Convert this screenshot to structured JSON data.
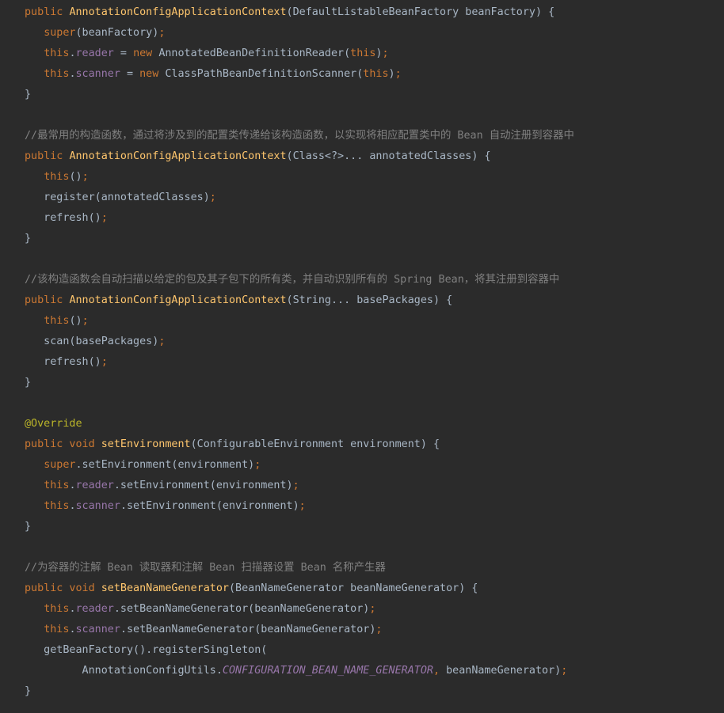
{
  "code_lines": [
    [
      {
        "t": "public ",
        "c": "kw"
      },
      {
        "t": "AnnotationConfigApplicationContext",
        "c": "fn"
      },
      {
        "t": "(DefaultListableBeanFactory beanFactory) {",
        "c": "txt"
      }
    ],
    [
      {
        "t": "   ",
        "c": "txt"
      },
      {
        "t": "super",
        "c": "kw"
      },
      {
        "t": "(beanFactory)",
        "c": "txt"
      },
      {
        "t": ";",
        "c": "kw"
      }
    ],
    [
      {
        "t": "   ",
        "c": "txt"
      },
      {
        "t": "this",
        "c": "kw"
      },
      {
        "t": ".",
        "c": "txt"
      },
      {
        "t": "reader",
        "c": "field"
      },
      {
        "t": " = ",
        "c": "txt"
      },
      {
        "t": "new ",
        "c": "kw"
      },
      {
        "t": "AnnotatedBeanDefinitionReader(",
        "c": "txt"
      },
      {
        "t": "this",
        "c": "kw"
      },
      {
        "t": ")",
        "c": "txt"
      },
      {
        "t": ";",
        "c": "kw"
      }
    ],
    [
      {
        "t": "   ",
        "c": "txt"
      },
      {
        "t": "this",
        "c": "kw"
      },
      {
        "t": ".",
        "c": "txt"
      },
      {
        "t": "scanner",
        "c": "field"
      },
      {
        "t": " = ",
        "c": "txt"
      },
      {
        "t": "new ",
        "c": "kw"
      },
      {
        "t": "ClassPathBeanDefinitionScanner(",
        "c": "txt"
      },
      {
        "t": "this",
        "c": "kw"
      },
      {
        "t": ")",
        "c": "txt"
      },
      {
        "t": ";",
        "c": "kw"
      }
    ],
    [
      {
        "t": "}",
        "c": "txt"
      }
    ],
    [],
    [
      {
        "t": "//最常用的构造函数，通过将涉及到的配置类传递给该构造函数，以实现将相应配置类中的 Bean 自动注册到容器中",
        "c": "cmt"
      }
    ],
    [
      {
        "t": "public ",
        "c": "kw"
      },
      {
        "t": "AnnotationConfigApplicationContext",
        "c": "fn"
      },
      {
        "t": "(Class<?>... annotatedClasses) {",
        "c": "txt"
      }
    ],
    [
      {
        "t": "   ",
        "c": "txt"
      },
      {
        "t": "this",
        "c": "kw"
      },
      {
        "t": "()",
        "c": "txt"
      },
      {
        "t": ";",
        "c": "kw"
      }
    ],
    [
      {
        "t": "   register(annotatedClasses)",
        "c": "txt"
      },
      {
        "t": ";",
        "c": "kw"
      }
    ],
    [
      {
        "t": "   refresh()",
        "c": "txt"
      },
      {
        "t": ";",
        "c": "kw"
      }
    ],
    [
      {
        "t": "}",
        "c": "txt"
      }
    ],
    [],
    [
      {
        "t": "//该构造函数会自动扫描以给定的包及其子包下的所有类，并自动识别所有的 Spring Bean，将其注册到容器中",
        "c": "cmt"
      }
    ],
    [
      {
        "t": "public ",
        "c": "kw"
      },
      {
        "t": "AnnotationConfigApplicationContext",
        "c": "fn"
      },
      {
        "t": "(String... basePackages) {",
        "c": "txt"
      }
    ],
    [
      {
        "t": "   ",
        "c": "txt"
      },
      {
        "t": "this",
        "c": "kw"
      },
      {
        "t": "()",
        "c": "txt"
      },
      {
        "t": ";",
        "c": "kw"
      }
    ],
    [
      {
        "t": "   scan(basePackages)",
        "c": "txt"
      },
      {
        "t": ";",
        "c": "kw"
      }
    ],
    [
      {
        "t": "   refresh()",
        "c": "txt"
      },
      {
        "t": ";",
        "c": "kw"
      }
    ],
    [
      {
        "t": "}",
        "c": "txt"
      }
    ],
    [],
    [
      {
        "t": "@Override",
        "c": "ann"
      }
    ],
    [
      {
        "t": "public void ",
        "c": "kw"
      },
      {
        "t": "setEnvironment",
        "c": "fn"
      },
      {
        "t": "(ConfigurableEnvironment environment) {",
        "c": "txt"
      }
    ],
    [
      {
        "t": "   ",
        "c": "txt"
      },
      {
        "t": "super",
        "c": "kw"
      },
      {
        "t": ".setEnvironment(environment)",
        "c": "txt"
      },
      {
        "t": ";",
        "c": "kw"
      }
    ],
    [
      {
        "t": "   ",
        "c": "txt"
      },
      {
        "t": "this",
        "c": "kw"
      },
      {
        "t": ".",
        "c": "txt"
      },
      {
        "t": "reader",
        "c": "field"
      },
      {
        "t": ".setEnvironment(environment)",
        "c": "txt"
      },
      {
        "t": ";",
        "c": "kw"
      }
    ],
    [
      {
        "t": "   ",
        "c": "txt"
      },
      {
        "t": "this",
        "c": "kw"
      },
      {
        "t": ".",
        "c": "txt"
      },
      {
        "t": "scanner",
        "c": "field"
      },
      {
        "t": ".setEnvironment(environment)",
        "c": "txt"
      },
      {
        "t": ";",
        "c": "kw"
      }
    ],
    [
      {
        "t": "}",
        "c": "txt"
      }
    ],
    [],
    [
      {
        "t": "//为容器的注解 Bean 读取器和注解 Bean 扫描器设置 Bean 名称产生器",
        "c": "cmt"
      }
    ],
    [
      {
        "t": "public void ",
        "c": "kw"
      },
      {
        "t": "setBeanNameGenerator",
        "c": "fn"
      },
      {
        "t": "(BeanNameGenerator beanNameGenerator) {",
        "c": "txt"
      }
    ],
    [
      {
        "t": "   ",
        "c": "txt"
      },
      {
        "t": "this",
        "c": "kw"
      },
      {
        "t": ".",
        "c": "txt"
      },
      {
        "t": "reader",
        "c": "field"
      },
      {
        "t": ".setBeanNameGenerator(beanNameGenerator)",
        "c": "txt"
      },
      {
        "t": ";",
        "c": "kw"
      }
    ],
    [
      {
        "t": "   ",
        "c": "txt"
      },
      {
        "t": "this",
        "c": "kw"
      },
      {
        "t": ".",
        "c": "txt"
      },
      {
        "t": "scanner",
        "c": "field"
      },
      {
        "t": ".setBeanNameGenerator(beanNameGenerator)",
        "c": "txt"
      },
      {
        "t": ";",
        "c": "kw"
      }
    ],
    [
      {
        "t": "   getBeanFactory().registerSingleton(",
        "c": "txt"
      }
    ],
    [
      {
        "t": "         AnnotationConfigUtils.",
        "c": "txt"
      },
      {
        "t": "CONFIGURATION_BEAN_NAME_GENERATOR",
        "c": "const"
      },
      {
        "t": ", ",
        "c": "kw"
      },
      {
        "t": "beanNameGenerator)",
        "c": "txt"
      },
      {
        "t": ";",
        "c": "kw"
      }
    ],
    [
      {
        "t": "}",
        "c": "txt"
      }
    ]
  ]
}
